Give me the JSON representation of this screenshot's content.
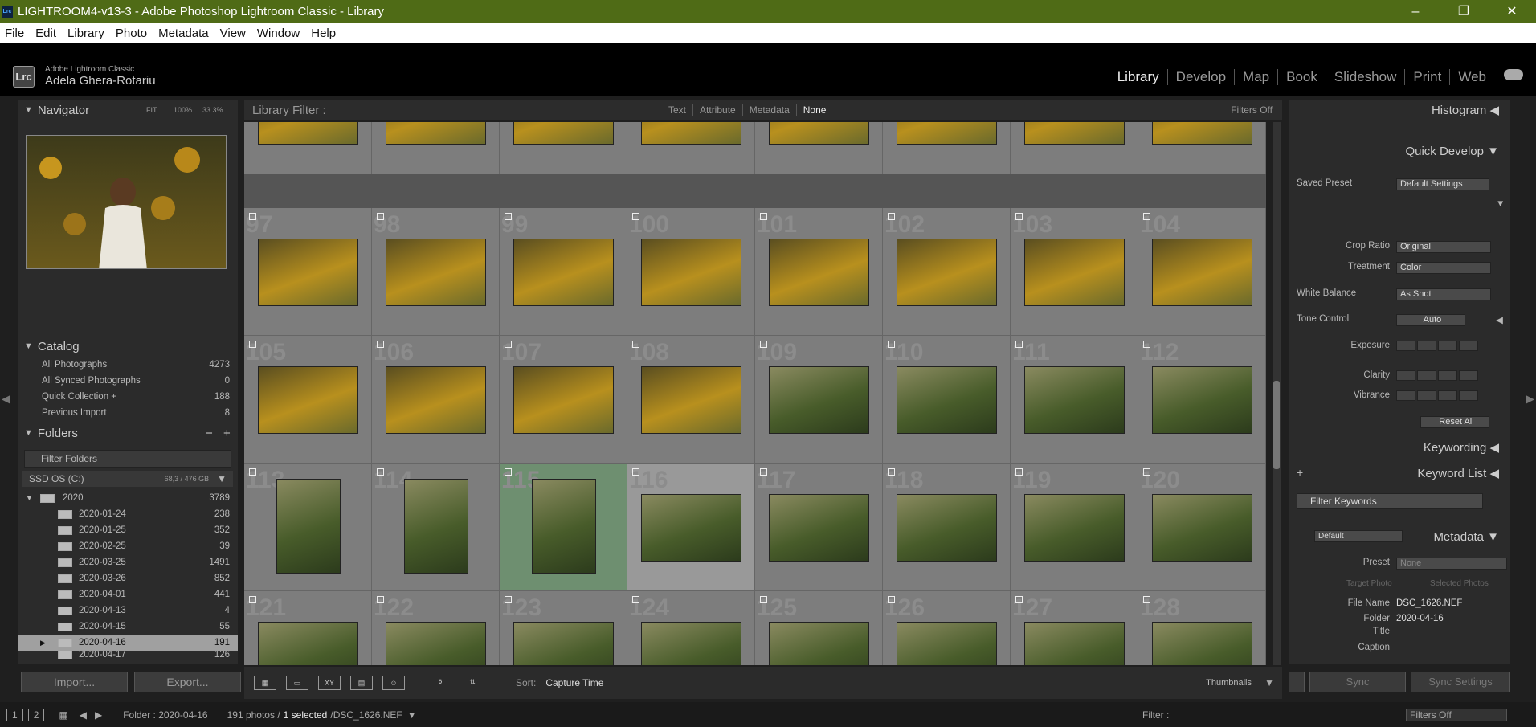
{
  "window": {
    "title": "LIGHTROOM4-v13-3 - Adobe Photoshop Lightroom Classic - Library",
    "app_badge": "Lrc",
    "minimize": "–",
    "restore": "❐",
    "close": "✕"
  },
  "menu": [
    "File",
    "Edit",
    "Library",
    "Photo",
    "Metadata",
    "View",
    "Window",
    "Help"
  ],
  "identity": {
    "badge": "Lrc",
    "line1": "Adobe Lightroom Classic",
    "line2": "Adela Ghera-Rotariu"
  },
  "modules": [
    "Library",
    "Develop",
    "Map",
    "Book",
    "Slideshow",
    "Print",
    "Web"
  ],
  "navigator": {
    "title": "Navigator",
    "zoom": [
      "FIT",
      "100%",
      "33.3%"
    ]
  },
  "catalog": {
    "title": "Catalog",
    "items": [
      {
        "label": "All Photographs",
        "count": "4273"
      },
      {
        "label": "All Synced Photographs",
        "count": "0"
      },
      {
        "label": "Quick Collection +",
        "count": "188"
      },
      {
        "label": "Previous Import",
        "count": "8"
      }
    ]
  },
  "folders": {
    "title": "Folders",
    "filter": "Filter Folders",
    "volume": {
      "name": "SSD OS (C:)",
      "size": "68,3 / 476 GB"
    },
    "year": {
      "label": "2020",
      "count": "3789"
    },
    "items": [
      {
        "label": "2020-01-24",
        "count": "238"
      },
      {
        "label": "2020-01-25",
        "count": "352"
      },
      {
        "label": "2020-02-25",
        "count": "39"
      },
      {
        "label": "2020-03-25",
        "count": "1491"
      },
      {
        "label": "2020-03-26",
        "count": "852"
      },
      {
        "label": "2020-04-01",
        "count": "441"
      },
      {
        "label": "2020-04-13",
        "count": "4"
      },
      {
        "label": "2020-04-15",
        "count": "55"
      },
      {
        "label": "2020-04-16",
        "count": "191"
      },
      {
        "label": "2020-04-17",
        "count": "126"
      }
    ]
  },
  "leftbuttons": {
    "import": "Import...",
    "export": "Export..."
  },
  "filterbar": {
    "label": "Library Filter :",
    "tabs": [
      "Text",
      "Attribute",
      "Metadata",
      "None"
    ],
    "filters": "Filters Off"
  },
  "grid": {
    "rows": [
      [
        "",
        "",
        "",
        "",
        "",
        "",
        "",
        ""
      ],
      [
        "97",
        "98",
        "99",
        "100",
        "101",
        "102",
        "103",
        "104"
      ],
      [
        "105",
        "106",
        "107",
        "108",
        "109",
        "110",
        "111",
        "112"
      ],
      [
        "113",
        "114",
        "115",
        "116",
        "117",
        "118",
        "119",
        "120"
      ],
      [
        "121",
        "122",
        "123",
        "124",
        "125",
        "126",
        "127",
        "128"
      ]
    ]
  },
  "toolbar": {
    "sort_label": "Sort:",
    "sort_value": "Capture Time",
    "thumbnails": "Thumbnails"
  },
  "right": {
    "histogram": "Histogram",
    "quick_develop": "Quick Develop",
    "saved_preset": "Saved Preset",
    "saved_preset_value": "Default Settings",
    "crop_ratio": "Crop Ratio",
    "crop_ratio_value": "Original",
    "treatment": "Treatment",
    "treatment_value": "Color",
    "white_balance": "White Balance",
    "white_balance_value": "As Shot",
    "tone_control": "Tone Control",
    "auto": "Auto",
    "exposure": "Exposure",
    "clarity": "Clarity",
    "vibrance": "Vibrance",
    "reset_all": "Reset All",
    "keywording": "Keywording",
    "keyword_list": "Keyword List",
    "filter_keywords": "Filter Keywords",
    "metadata": "Metadata",
    "metadata_preset_value": "Default",
    "preset": "Preset",
    "preset_value": "None",
    "target_photo": "Target Photo",
    "selected_photos": "Selected Photos",
    "file_name": "File Name",
    "file_name_value": "DSC_1626.NEF",
    "folder": "Folder",
    "folder_value": "2020-04-16",
    "title": "Title",
    "caption": "Caption"
  },
  "sync": {
    "sync": "Sync",
    "sync_settings": "Sync Settings"
  },
  "status": {
    "pages": [
      "1",
      "2"
    ],
    "folder": "Folder : 2020-04-16",
    "count": "191 photos /",
    "selected": "1 selected",
    "file": "/DSC_1626.NEF",
    "filter_label": "Filter :",
    "filter_value": "Filters Off"
  }
}
